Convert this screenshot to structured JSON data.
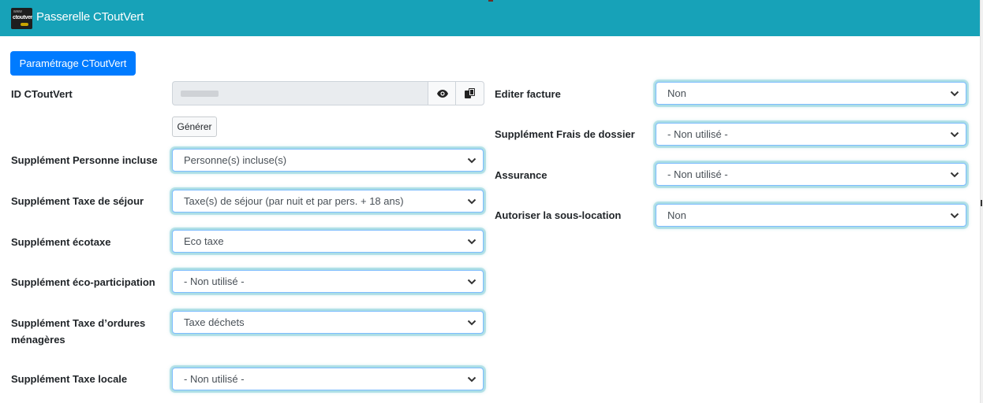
{
  "header": {
    "title": "Passerelle CToutVert",
    "logo_text": [
      "www",
      "ctoutvert",
      ".com"
    ],
    "bg_color": "#17a2b8"
  },
  "settings_button": {
    "label": "Paramétrage CToutVert",
    "color": "#007bff"
  },
  "id_field": {
    "label": "ID CToutVert",
    "value_masked": true,
    "show_icon": "eye-icon",
    "copy_icon": "copy-icon",
    "generate_label": "Générer"
  },
  "left_fields": [
    {
      "label": "Supplément Personne incluse",
      "value": "Personne(s) incluse(s)"
    },
    {
      "label": "Supplément Taxe de séjour",
      "value": "Taxe(s) de séjour (par nuit et par pers. + 18 ans)"
    },
    {
      "label": "Supplément écotaxe",
      "value": "Eco taxe"
    },
    {
      "label": "Supplément éco-participation",
      "value": "- Non utilisé -"
    },
    {
      "label": "Supplément Taxe d’ordures ménagères",
      "value": "Taxe déchets"
    },
    {
      "label": "Supplément Taxe locale",
      "value": "- Non utilisé -"
    }
  ],
  "right_fields": [
    {
      "label": "Editer facture",
      "value": "Non"
    },
    {
      "label": "Supplément Frais de dossier",
      "value": "- Non utilisé -"
    },
    {
      "label": "Assurance",
      "value": "- Non utilisé -"
    },
    {
      "label": "Autoriser la sous-location",
      "value": "Non"
    }
  ],
  "icons": {
    "dropdown": "chevron-down-icon"
  },
  "colors": {
    "focus_border": "#80bdff",
    "input_disabled": "#e9ecef"
  }
}
